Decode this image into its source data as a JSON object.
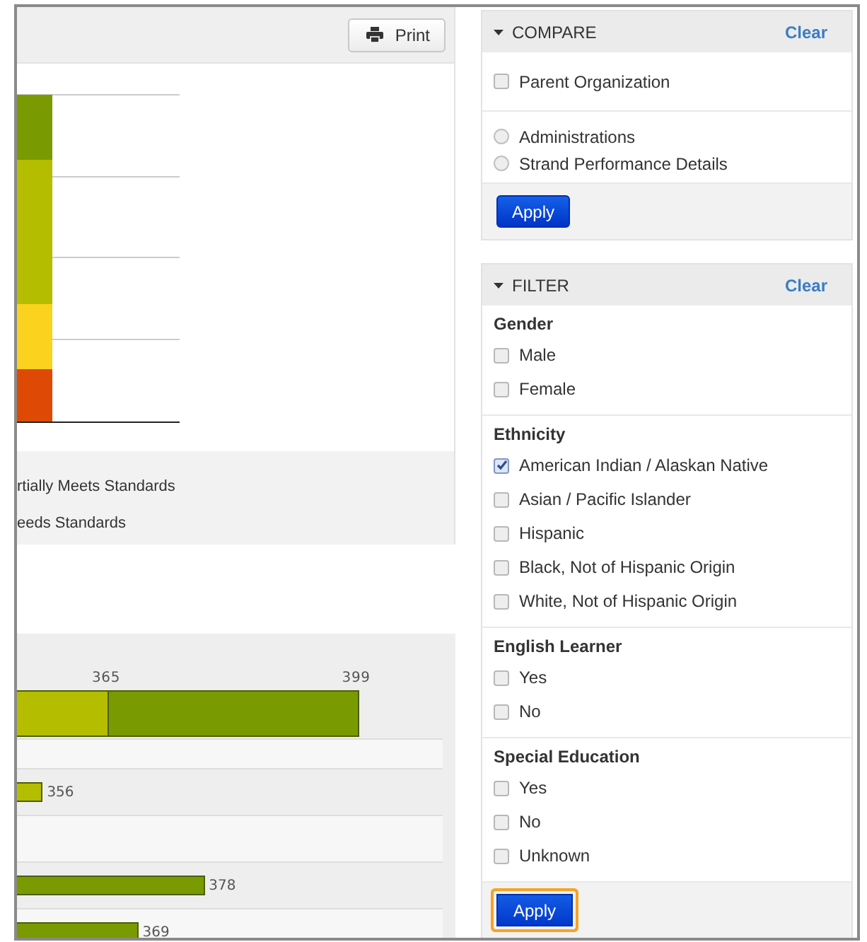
{
  "print_button": {
    "label": "Print"
  },
  "legend": [
    "rtially Meets Standards",
    "eeds Standards"
  ],
  "score_chart": {
    "total_segments": [
      {
        "value": "365",
        "color": "#b5bd00"
      },
      {
        "value": "399",
        "color": "#7a9a01"
      }
    ],
    "rows": [
      {
        "kind": "blank"
      },
      {
        "kind": "bar",
        "value": "356",
        "color": "#b5bd00"
      },
      {
        "kind": "blank"
      },
      {
        "kind": "bar",
        "value": "378",
        "color": "#7a9a01"
      },
      {
        "kind": "bar",
        "value": "369",
        "color": "#7a9a01"
      }
    ]
  },
  "compare": {
    "title": "COMPARE",
    "clear": "Clear",
    "checkboxes": [
      {
        "label": "Parent Organization",
        "checked": false
      }
    ],
    "radios": [
      {
        "label": "Administrations",
        "selected": false
      },
      {
        "label": "Strand Performance Details",
        "selected": false
      }
    ],
    "apply": {
      "label": "Apply",
      "focused": false
    }
  },
  "filter": {
    "title": "FILTER",
    "clear": "Clear",
    "groups": [
      {
        "heading": "Gender",
        "options": [
          {
            "label": "Male",
            "checked": false
          },
          {
            "label": "Female",
            "checked": false
          }
        ]
      },
      {
        "heading": "Ethnicity",
        "options": [
          {
            "label": "American Indian / Alaskan Native",
            "checked": true
          },
          {
            "label": "Asian / Pacific Islander",
            "checked": false
          },
          {
            "label": "Hispanic",
            "checked": false
          },
          {
            "label": "Black, Not of Hispanic Origin",
            "checked": false
          },
          {
            "label": "White, Not of Hispanic Origin",
            "checked": false
          }
        ]
      },
      {
        "heading": "English Learner",
        "options": [
          {
            "label": "Yes",
            "checked": false
          },
          {
            "label": "No",
            "checked": false
          }
        ]
      },
      {
        "heading": "Special Education",
        "options": [
          {
            "label": "Yes",
            "checked": false
          },
          {
            "label": "No",
            "checked": false
          },
          {
            "label": "Unknown",
            "checked": false
          }
        ]
      }
    ],
    "apply": {
      "label": "Apply",
      "focused": true
    }
  }
}
